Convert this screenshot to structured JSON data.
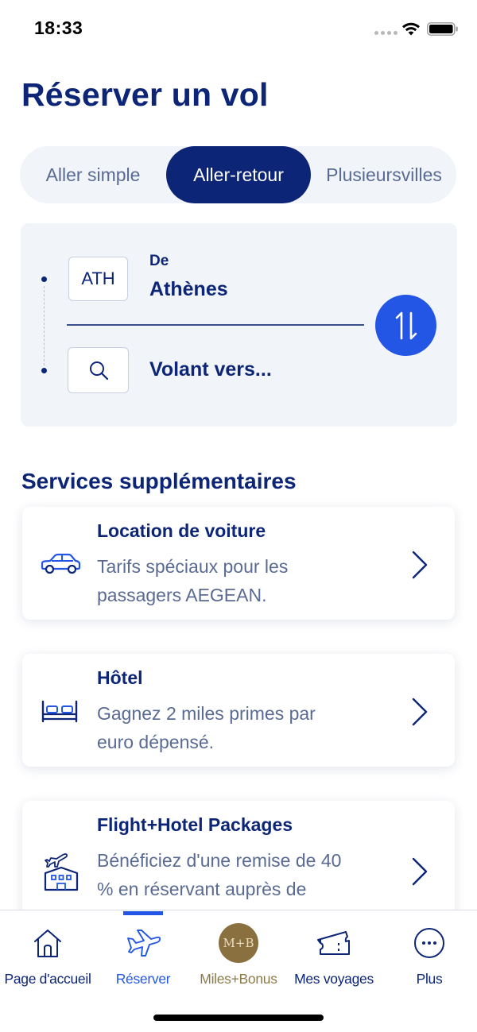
{
  "status_bar": {
    "time": "18:33"
  },
  "page": {
    "title": "Réserver un vol"
  },
  "trip_types": {
    "one_way": "Aller simple",
    "round_trip": "Aller-retour",
    "multi_city_line1": "Plusieurs",
    "multi_city_line2": "villes",
    "selected": "Aller-retour"
  },
  "search": {
    "from_code": "ATH",
    "from_label": "De",
    "from_city": "Athènes",
    "to_placeholder": "Volant vers..."
  },
  "services": {
    "title": "Services supplémentaires",
    "items": [
      {
        "title": "Location de voiture",
        "desc_line1": "Tarifs spéciaux pour les",
        "desc_line2": "passagers AEGEAN.",
        "icon": "car-icon"
      },
      {
        "title": "Hôtel",
        "desc_line1": "Gagnez 2 miles primes par",
        "desc_line2": "euro dépensé.",
        "icon": "bed-icon"
      },
      {
        "title": "Flight+Hotel Packages",
        "desc_line1": "Bénéficiez d'une remise de 40",
        "desc_line2": "% en réservant auprès de",
        "icon": "plane-hotel-icon"
      }
    ]
  },
  "nav": {
    "items": [
      {
        "label": "Page d'accueil",
        "icon": "home-icon"
      },
      {
        "label": "Réserver",
        "icon": "plane-icon",
        "active": true
      },
      {
        "label": "Miles+Bonus",
        "icon": "miles-bonus-icon",
        "badge": "M+B"
      },
      {
        "label": "Mes voyages",
        "icon": "ticket-icon"
      },
      {
        "label": "Plus",
        "icon": "more-icon"
      }
    ]
  },
  "colors": {
    "primary": "#0c2577",
    "accent": "#2456e6",
    "muted": "#5a6b93",
    "panel": "#f1f4f9",
    "gold": "#8a6f3f"
  }
}
